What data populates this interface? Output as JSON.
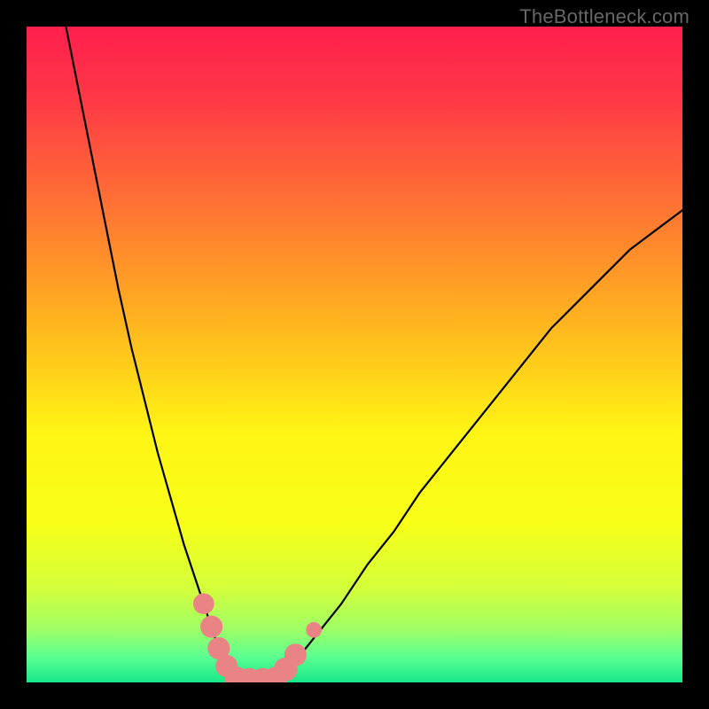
{
  "watermark": "TheBottleneck.com",
  "chart_data": {
    "type": "line",
    "title": "",
    "xlabel": "",
    "ylabel": "",
    "xlim": [
      0,
      100
    ],
    "ylim": [
      0,
      100
    ],
    "grid": false,
    "legend": false,
    "background_gradient_stops": [
      {
        "offset": 0.0,
        "color": "#ff1f4e"
      },
      {
        "offset": 0.1,
        "color": "#ff3547"
      },
      {
        "offset": 0.25,
        "color": "#ff6a36"
      },
      {
        "offset": 0.45,
        "color": "#ffb41e"
      },
      {
        "offset": 0.62,
        "color": "#fff514"
      },
      {
        "offset": 0.76,
        "color": "#f7ff18"
      },
      {
        "offset": 0.86,
        "color": "#d2ff3c"
      },
      {
        "offset": 0.92,
        "color": "#9dff67"
      },
      {
        "offset": 0.96,
        "color": "#5dff91"
      },
      {
        "offset": 1.0,
        "color": "#17e789"
      }
    ],
    "series": [
      {
        "name": "left-arm",
        "color": "#000000",
        "width": 2.2,
        "x": [
          6,
          8,
          10,
          12,
          14,
          16,
          18,
          20,
          22,
          24,
          26,
          27,
          28,
          29,
          30,
          31,
          32
        ],
        "y": [
          100,
          90,
          80,
          70,
          60,
          51,
          43,
          35,
          28,
          21,
          15,
          12,
          9,
          6,
          4,
          2,
          0
        ]
      },
      {
        "name": "valley-floor",
        "color": "#000000",
        "width": 2.2,
        "x": [
          32,
          34,
          36,
          38
        ],
        "y": [
          0,
          0,
          0,
          0
        ]
      },
      {
        "name": "right-arm",
        "color": "#000000",
        "width": 2.2,
        "x": [
          38,
          40,
          44,
          48,
          52,
          56,
          60,
          64,
          68,
          72,
          76,
          80,
          84,
          88,
          92,
          96,
          100
        ],
        "y": [
          0,
          2,
          7,
          12,
          18,
          23,
          29,
          34,
          39,
          44,
          49,
          54,
          58,
          62,
          66,
          69,
          72
        ]
      }
    ],
    "markers": [
      {
        "name": "left-blob-1",
        "cx": 27.0,
        "cy": 12.0,
        "r": 1.6,
        "color": "#e98384"
      },
      {
        "name": "left-blob-2",
        "cx": 28.2,
        "cy": 8.5,
        "r": 1.7,
        "color": "#e98384"
      },
      {
        "name": "left-blob-3",
        "cx": 29.3,
        "cy": 5.2,
        "r": 1.7,
        "color": "#e98384"
      },
      {
        "name": "left-blob-4",
        "cx": 30.5,
        "cy": 2.5,
        "r": 1.7,
        "color": "#e98384"
      },
      {
        "name": "floor-blob-1",
        "cx": 32.0,
        "cy": 0.6,
        "r": 1.8,
        "color": "#e98384"
      },
      {
        "name": "floor-blob-2",
        "cx": 34.0,
        "cy": 0.4,
        "r": 1.8,
        "color": "#e98384"
      },
      {
        "name": "floor-blob-3",
        "cx": 36.0,
        "cy": 0.4,
        "r": 1.8,
        "color": "#e98384"
      },
      {
        "name": "floor-blob-4",
        "cx": 38.0,
        "cy": 0.6,
        "r": 1.8,
        "color": "#e98384"
      },
      {
        "name": "right-blob-1",
        "cx": 39.5,
        "cy": 2.0,
        "r": 1.8,
        "color": "#e98384"
      },
      {
        "name": "right-blob-2",
        "cx": 41.0,
        "cy": 4.2,
        "r": 1.7,
        "color": "#e98384"
      },
      {
        "name": "right-dot",
        "cx": 43.8,
        "cy": 8.0,
        "r": 1.2,
        "color": "#e98384"
      }
    ]
  }
}
